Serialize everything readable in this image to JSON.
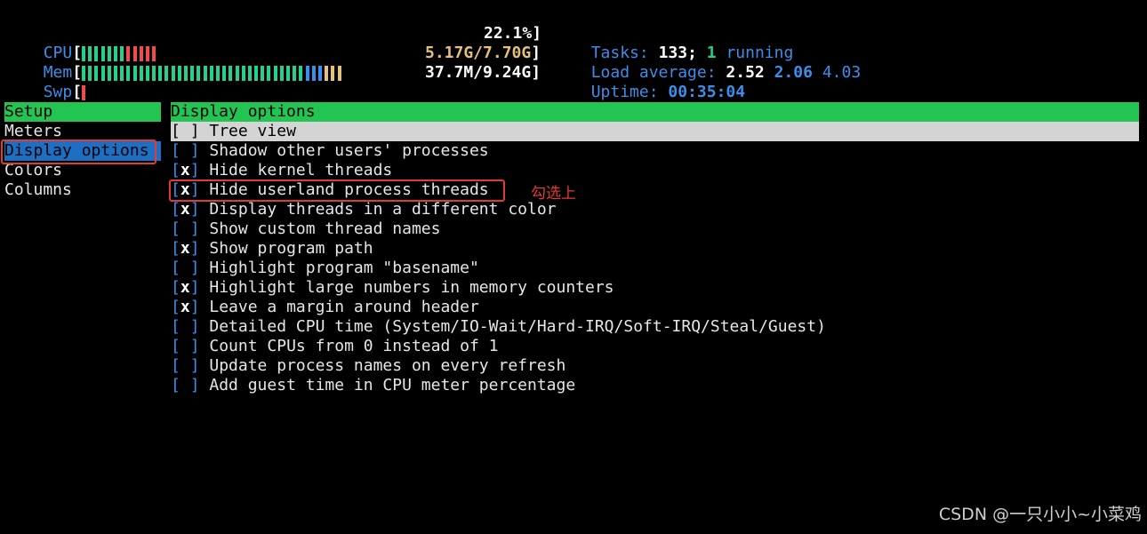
{
  "header": {
    "cpu": {
      "label": "CPU",
      "value": "22.1%",
      "green_segments": 7,
      "red_segments": 5
    },
    "mem": {
      "label": "Mem",
      "value": "5.17G/7.70G",
      "green_segments": 35,
      "blue_segments": 3,
      "yellow_segments": 3
    },
    "swp": {
      "label": "Swp",
      "value": "37.7M/9.24G",
      "red_segments": 1
    },
    "tasks": {
      "label": "Tasks:",
      "count": "133;",
      "running_count": "1",
      "running_label": "running"
    },
    "load": {
      "label": "Load average:",
      "v1": "2.52",
      "v2": "2.06",
      "v3": "4.03"
    },
    "uptime": {
      "label": "Uptime:",
      "value": "00:35:04"
    }
  },
  "left_menu": {
    "header": "Setup",
    "items": [
      {
        "label": "Meters"
      },
      {
        "label": "Display options",
        "selected": true
      },
      {
        "label": "Colors"
      },
      {
        "label": "Columns"
      }
    ]
  },
  "panel": {
    "title": "Display options",
    "options": [
      {
        "label": "Tree view",
        "checked": false,
        "highlighted": true
      },
      {
        "label": "Shadow other users' processes",
        "checked": false
      },
      {
        "label": "Hide kernel threads",
        "checked": true
      },
      {
        "label": "Hide userland process threads",
        "checked": true
      },
      {
        "label": "Display threads in a different color",
        "checked": true
      },
      {
        "label": "Show custom thread names",
        "checked": false
      },
      {
        "label": "Show program path",
        "checked": true
      },
      {
        "label": "Highlight program \"basename\"",
        "checked": false
      },
      {
        "label": "Highlight large numbers in memory counters",
        "checked": true
      },
      {
        "label": "Leave a margin around header",
        "checked": true
      },
      {
        "label": "Detailed CPU time (System/IO-Wait/Hard-IRQ/Soft-IRQ/Steal/Guest)",
        "checked": false
      },
      {
        "label": "Count CPUs from 0 instead of 1",
        "checked": false
      },
      {
        "label": "Update process names on every refresh",
        "checked": false
      },
      {
        "label": "Add guest time in CPU meter percentage",
        "checked": false
      }
    ]
  },
  "annotation": {
    "note": "勾选上"
  },
  "watermark": "CSDN @一只小小~小菜鸡",
  "colors": {
    "background": "#000000",
    "header_green": "#23c552",
    "selection_blue": "#1d6fc4",
    "accent_blue": "#3b8eea",
    "annotation_red": "#e53935"
  }
}
